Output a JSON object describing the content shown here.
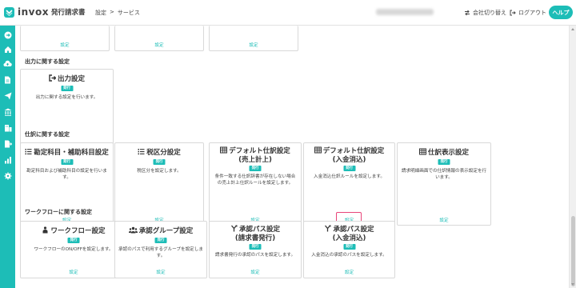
{
  "header": {
    "brand": "invox",
    "product": "発行請求書",
    "breadcrumb": [
      "設定",
      "サービス"
    ],
    "breadcrumb_sep": ">",
    "switch_company": "会社切り替え",
    "logout": "ログアウト",
    "help": "ヘルプ"
  },
  "colors": {
    "accent": "#1dbdb7",
    "highlight": "#e8457a"
  },
  "sidebar": {
    "icons": [
      "arrow-right-icon",
      "home-icon",
      "cloud-upload-icon",
      "document-icon",
      "send-icon",
      "bank-icon",
      "building-icon",
      "export-icon",
      "chart-icon",
      "gear-icon"
    ]
  },
  "top_row": {
    "links": [
      "設定",
      "設定",
      "設定"
    ]
  },
  "sections": {
    "output": {
      "title": "出力に関する設定",
      "card": {
        "title": "出力設定",
        "badge": "発行",
        "desc": "出力に関する設定を行います。",
        "link": "設定",
        "icon": "logout-icon"
      }
    },
    "journal": {
      "title": "仕訳に関する設定",
      "cards": [
        {
          "title": "勘定科目・補助科目設定",
          "badge": "発行",
          "desc": "勘定科目および補助科目の設定を行います。",
          "link": "設定",
          "icon": "list-icon"
        },
        {
          "title": "税区分設定",
          "badge": "発行",
          "desc": "税区分を設定します。",
          "link": "設定",
          "icon": "list-icon"
        },
        {
          "title": "デフォルト仕訳設定",
          "title2": "(売上計上)",
          "badge": "発行",
          "desc": "条件一致する仕訳辞書が存在しない場合の売上計上仕訳ルールを設定します。",
          "link": "設定",
          "icon": "table-icon"
        },
        {
          "title": "デフォルト仕訳設定",
          "title2": "(入金消込)",
          "badge": "発行",
          "desc": "入金消込仕訳ルールを設定します。",
          "link": "設定",
          "icon": "table-icon"
        },
        {
          "title": "仕訳表示設定",
          "badge": "発行",
          "desc": "請求明細画面での仕訳情報の表示設定を行います。",
          "link": "設定",
          "icon": "table-icon"
        }
      ]
    },
    "workflow": {
      "title": "ワークフローに関する設定",
      "cards": [
        {
          "title": "ワークフロー設定",
          "badge": "発行",
          "desc": "ワークフローのON/OFFを設定します。",
          "link": "設定",
          "icon": "workflow-icon"
        },
        {
          "title": "承認グループ設定",
          "badge": "発行",
          "desc": "承認のパスで利用するグループを設定します。",
          "link": "設定",
          "icon": "group-icon"
        },
        {
          "title": "承認パス設定",
          "title2": "(請求書発行)",
          "badge": "発行",
          "desc": "請求書発行の承認のパスを設定します。",
          "link": "設定",
          "icon": "path-icon"
        },
        {
          "title": "承認パス設定",
          "title2": "(入金消込)",
          "badge": "発行",
          "desc": "入金消込の承認のパスを設定します。",
          "link": "設定",
          "icon": "path-icon"
        }
      ]
    }
  }
}
